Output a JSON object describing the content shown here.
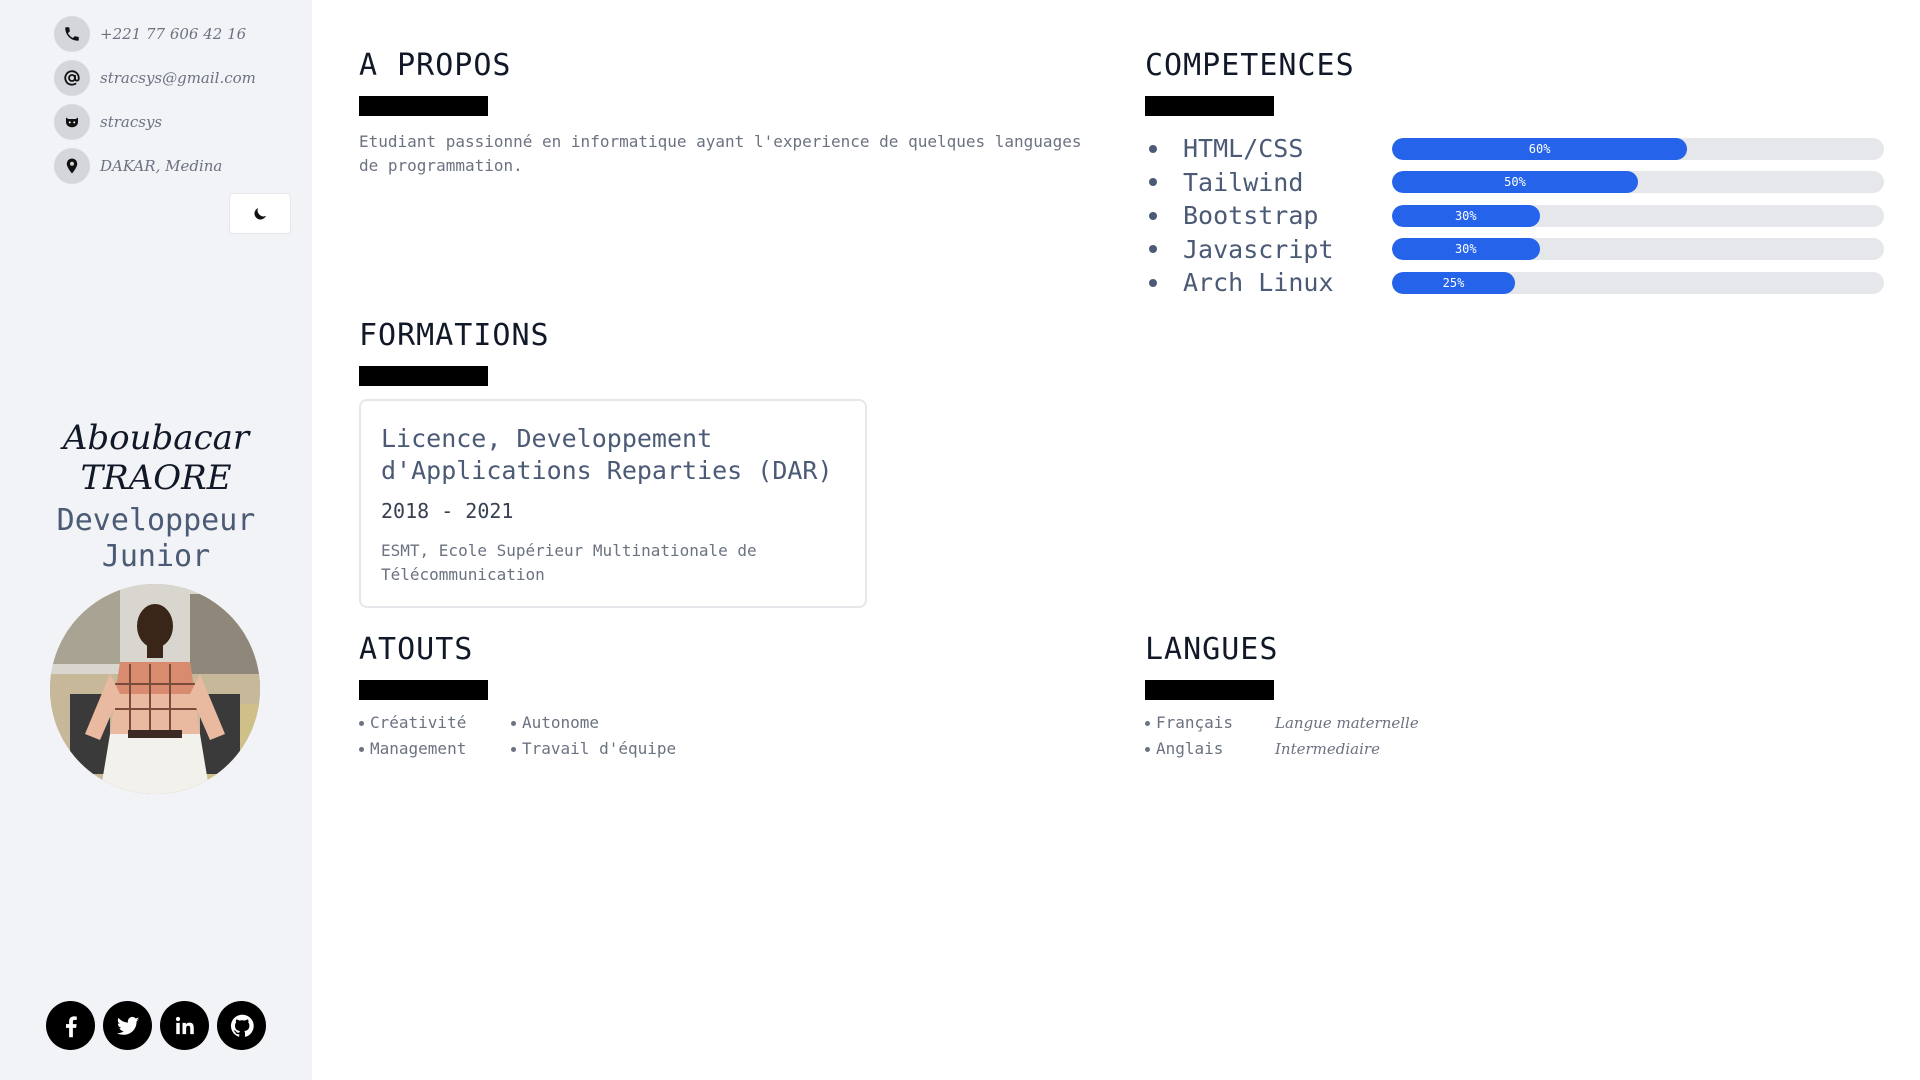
{
  "contact": {
    "phone": "+221 77 606 42 16",
    "email": "stracsys@gmail.com",
    "github": "stracsys",
    "location": "DAKAR, Medina"
  },
  "profile": {
    "first_name": "Aboubacar",
    "last_name": "TRAORE",
    "role_line1": "Developpeur",
    "role_line2": "Junior"
  },
  "sections": {
    "about": "A PROPOS",
    "skills": "COMPETENCES",
    "formations": "FORMATIONS",
    "atouts": "ATOUTS",
    "langues": "LANGUES"
  },
  "about": {
    "text": "Etudiant passionné en informatique ayant l'experience de quelques languages de programmation."
  },
  "skills": [
    {
      "name": "HTML/CSS",
      "percent": 60,
      "label": "60%"
    },
    {
      "name": "Tailwind",
      "percent": 50,
      "label": "50%"
    },
    {
      "name": "Bootstrap",
      "percent": 30,
      "label": "30%"
    },
    {
      "name": "Javascript",
      "percent": 30,
      "label": "30%"
    },
    {
      "name": "Arch Linux",
      "percent": 25,
      "label": "25%"
    }
  ],
  "formation": {
    "title": "Licence, Developpement d'Applications Reparties (DAR)",
    "years": "2018 - 2021",
    "school": "ESMT, Ecole Supérieur Multinationale de Télécommunication"
  },
  "atouts": [
    "Créativité",
    "Autonome",
    "Management",
    "Travail d'équipe"
  ],
  "langues": [
    {
      "name": "Français",
      "level": "Langue maternelle"
    },
    {
      "name": "Anglais",
      "level": "Intermediaire"
    }
  ],
  "colors": {
    "sidebar_bg": "#f1f3f7",
    "accent": "#2563eb",
    "track": "#e5e7eb",
    "muted_text": "#6b7280",
    "slate_text": "#4b5a75"
  },
  "icons": {
    "contact": [
      "phone-icon",
      "at-sign-icon",
      "github-icon",
      "location-pin-icon"
    ],
    "theme": "moon-icon",
    "socials": [
      "facebook-icon",
      "twitter-icon",
      "linkedin-icon",
      "github-icon"
    ]
  }
}
